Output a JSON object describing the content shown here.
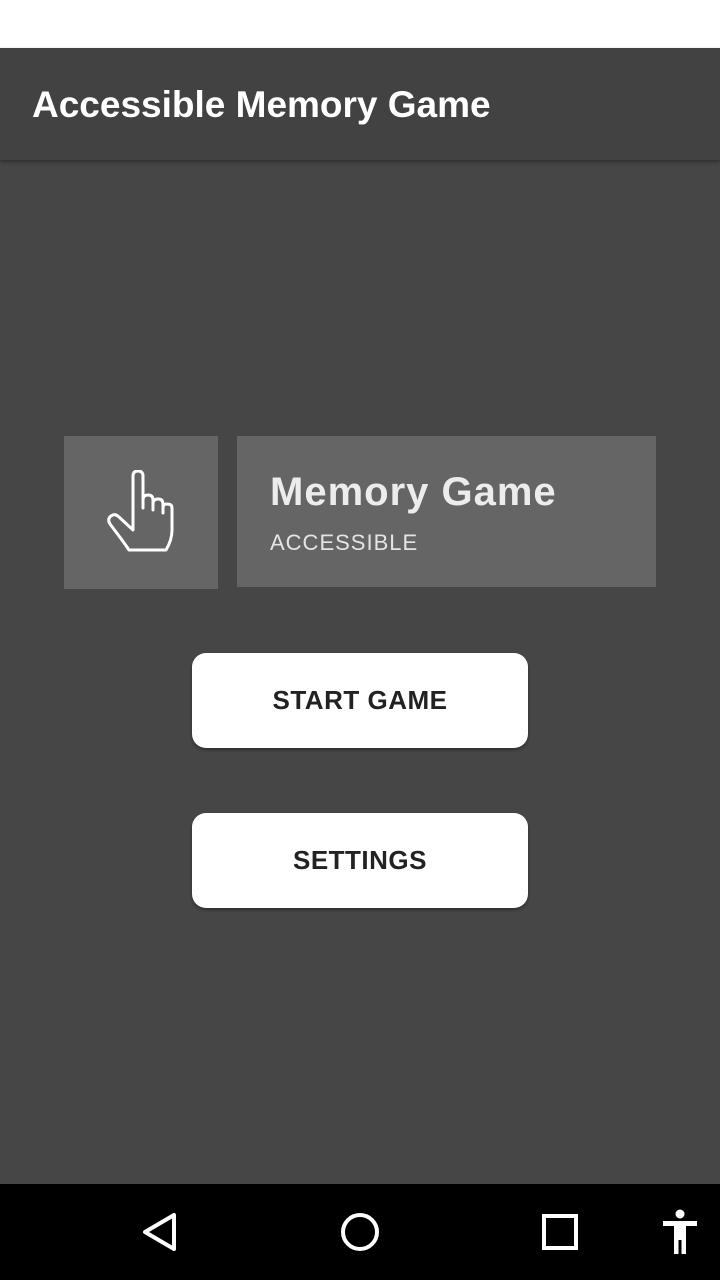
{
  "app_bar": {
    "title": "Accessible Memory Game"
  },
  "logo": {
    "icon": "pointing-hand-icon",
    "title": "Memory Game",
    "subtitle": "ACCESSIBLE"
  },
  "buttons": {
    "start_label": "START GAME",
    "settings_label": "SETTINGS"
  },
  "nav_bar": {
    "back_icon": "back-triangle-icon",
    "home_icon": "home-circle-icon",
    "recents_icon": "recents-square-icon",
    "accessibility_icon": "accessibility-person-icon"
  },
  "colors": {
    "background": "#464646",
    "app_bar": "#424242",
    "logo_tile": "#656565",
    "button": "#ffffff",
    "nav_bar": "#000000"
  }
}
